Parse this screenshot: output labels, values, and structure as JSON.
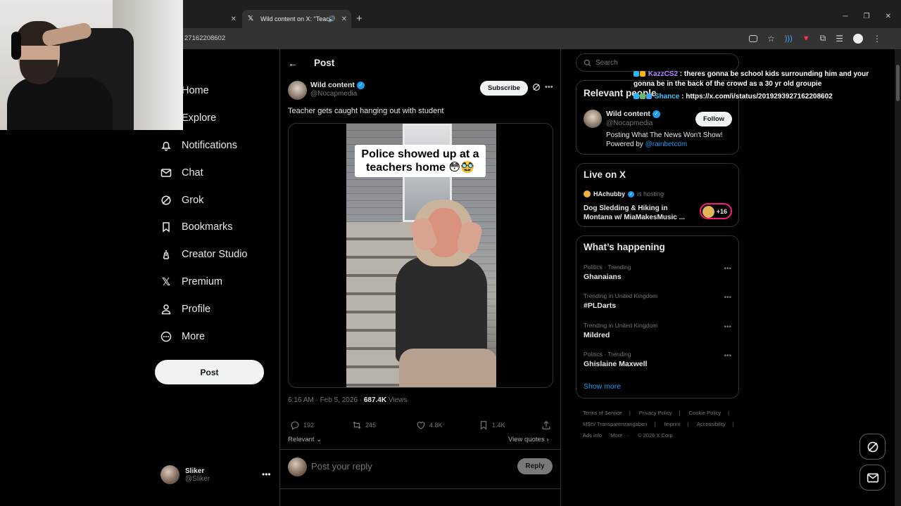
{
  "browser": {
    "tabs": [
      {
        "label": ""
      },
      {
        "label": "Wild content on X: \"Teache"
      }
    ],
    "url": "27162208602",
    "new_tab": "+"
  },
  "nav": {
    "items": [
      {
        "label": "Home",
        "icon": "home-icon"
      },
      {
        "label": "Explore",
        "icon": "search-icon"
      },
      {
        "label": "Notifications",
        "icon": "bell-icon"
      },
      {
        "label": "Chat",
        "icon": "mail-icon"
      },
      {
        "label": "Grok",
        "icon": "grok-icon"
      },
      {
        "label": "Bookmarks",
        "icon": "bookmark-icon"
      },
      {
        "label": "Creator Studio",
        "icon": "creator-studio-icon"
      },
      {
        "label": "Premium",
        "icon": "x-logo-icon"
      },
      {
        "label": "Profile",
        "icon": "person-icon"
      },
      {
        "label": "More",
        "icon": "more-circle-icon"
      }
    ],
    "post_button": "Post",
    "account": {
      "name": "Sliker",
      "handle": "@Sliker"
    }
  },
  "post": {
    "header_title": "Post",
    "author_name": "Wild content",
    "author_handle": "@Nocapmedia",
    "subscribe_label": "Subscribe",
    "text": "Teacher gets caught hanging out with student",
    "video_caption": "Police showed up at a teachers home 😳🥸",
    "time": "6:16 AM · Feb 5, 2026 · ",
    "views_count": "687.4K",
    "views_label": " Views",
    "stats": {
      "replies": "192",
      "reposts": "245",
      "likes": "4.8K",
      "bookmarks": "1.4K"
    },
    "sort_label": "Relevant",
    "view_quotes": "View quotes",
    "reply_placeholder": "Post your reply",
    "reply_button": "Reply"
  },
  "sidebar": {
    "search_placeholder": "Search",
    "relevant_title": "Relevant people",
    "relevant_person": {
      "name": "Wild content",
      "handle": "@Nocapmedia",
      "follow_label": "Follow",
      "bio": "Posting What The News Won't Show! Powered by ",
      "bio_link": "@rainbetcom"
    },
    "live_title": "Live on X",
    "live": {
      "host": "HAchubby",
      "hosting": "is hosting",
      "title": "Dog Sledding & Hiking in Montana w/ MiaMakesMusic ...",
      "listeners": "+16"
    },
    "happening_title": "What’s happening",
    "trends": [
      {
        "category": "Politics · Trending",
        "name": "Ghanaians"
      },
      {
        "category": "Trending in United Kingdom",
        "name": "#PLDarts"
      },
      {
        "category": "Trending in United Kingdom",
        "name": "Mildred"
      },
      {
        "category": "Politics · Trending",
        "name": "Ghislaine Maxwell"
      }
    ],
    "show_more": "Show more",
    "footer": [
      "Terms of Service",
      "|",
      "Privacy Policy",
      "|",
      "Cookie Policy",
      "|",
      "MStV Transparenzangaben",
      "|",
      "Imprint",
      "|",
      "Accessibility",
      "|",
      "Ads info",
      "More ···",
      "© 2026 X Corp."
    ]
  },
  "chat": [
    {
      "user": "KazzCS2",
      "message": " : theres gonna be school kids surrounding him and your gonna be in the back of the crowd as a 30 yr old groupie"
    },
    {
      "user": "Shance",
      "message": " : https://x.com/i/status/2019293927162208602"
    }
  ],
  "colors": {
    "accent": "#1d9bf0",
    "background": "#000000",
    "border": "#2f3336",
    "live_ring": "#f91880"
  }
}
